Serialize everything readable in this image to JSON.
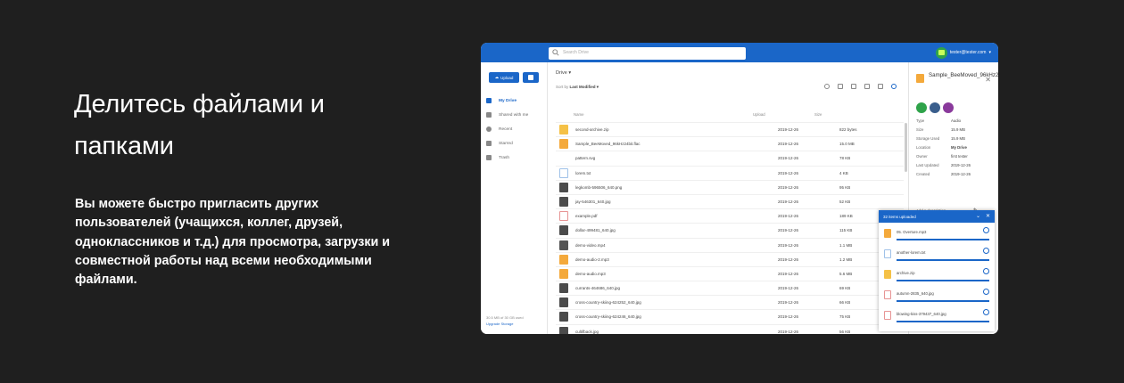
{
  "intro": {
    "headline": "Делитесь файлами и папками",
    "description": "Вы можете быстро пригласить других пользователей (учащихся, коллег, друзей, одноклассников и т.д.) для просмотра, загрузки и совместной работы над всеми необходимыми файлами."
  },
  "app": {
    "search_placeholder": "Search Drive",
    "user_email": "tester@tester.com",
    "upload_label": "Upload",
    "nav": [
      {
        "label": "My Drive",
        "icon": "drive-icon",
        "active": true
      },
      {
        "label": "Shared with me",
        "icon": "people-icon",
        "active": false
      },
      {
        "label": "Recent",
        "icon": "clock-icon",
        "active": false
      },
      {
        "label": "Starred",
        "icon": "star-icon",
        "active": false
      },
      {
        "label": "Trash",
        "icon": "trash-icon",
        "active": false
      }
    ],
    "quota_text": "30.5 MB of 30 GB used",
    "upgrade_label": "Upgrade Storage",
    "breadcrumb": "Drive ▾",
    "sort_prefix": "Sort by",
    "sort_value": "Last Modified ▾",
    "columns": {
      "name": "Name",
      "date": "Upload",
      "size": "Size"
    },
    "files": [
      {
        "name": "second-archive.zip",
        "date": "2019-12-26",
        "size": "822 bytes",
        "type": "zip"
      },
      {
        "name": "Sample_BeeMoved_96kHz24bit.flac",
        "date": "2019-12-26",
        "size": "15.0 MB",
        "type": "aud"
      },
      {
        "name": "pattern.svg",
        "date": "2019-12-26",
        "size": "78 KB",
        "type": "blank"
      },
      {
        "name": "lorem.txt",
        "date": "2019-12-26",
        "size": "4 KB",
        "type": "txt"
      },
      {
        "name": "legkomb-596506_640.png",
        "date": "2019-12-26",
        "size": "95 KB",
        "type": "img"
      },
      {
        "name": "jay-546301_640.jpg",
        "date": "2019-12-26",
        "size": "52 KB",
        "type": "img"
      },
      {
        "name": "example.pdf",
        "date": "2019-12-26",
        "size": "189 KB",
        "type": "pdf"
      },
      {
        "name": "dollar-499481_640.jpg",
        "date": "2019-12-26",
        "size": "115 KB",
        "type": "img"
      },
      {
        "name": "demo-video.mp4",
        "date": "2019-12-26",
        "size": "1.1 MB",
        "type": "vid"
      },
      {
        "name": "demo-audio-2.mp3",
        "date": "2019-12-26",
        "size": "1.2 MB",
        "type": "aud"
      },
      {
        "name": "demo-audio.mp3",
        "date": "2019-12-26",
        "size": "5.6 MB",
        "type": "aud"
      },
      {
        "name": "currants-464686_640.jpg",
        "date": "2019-12-26",
        "size": "69 KB",
        "type": "img"
      },
      {
        "name": "cross-country-skiing-624252_640.jpg",
        "date": "2019-12-26",
        "size": "66 KB",
        "type": "img"
      },
      {
        "name": "cross-country-skiing-624246_640.jpg",
        "date": "2019-12-26",
        "size": "75 KB",
        "type": "img"
      },
      {
        "name": "cultifback.jpg",
        "date": "2019-12-26",
        "size": "56 KB",
        "type": "img"
      }
    ],
    "detail": {
      "title": "Sample_BeeMoved_96kHz24bit.flac",
      "rows": [
        {
          "label": "Type",
          "value": "Audio"
        },
        {
          "label": "Size",
          "value": "15.9 MB"
        },
        {
          "label": "Storage Used",
          "value": "15.9 MB"
        },
        {
          "label": "Location",
          "value": "My Drive"
        },
        {
          "label": "Owner",
          "value": "first tester"
        },
        {
          "label": "Last Updated",
          "value": "2019-12-26"
        },
        {
          "label": "Created",
          "value": "2019-12-26"
        }
      ],
      "add_description": "Add a description"
    },
    "uploads": {
      "title": "32 items uploaded",
      "items": [
        {
          "name": "05. Overture.mp3",
          "type": "aud"
        },
        {
          "name": "another-lorem.txt",
          "type": "txt"
        },
        {
          "name": "archive.zip",
          "type": "zip"
        },
        {
          "name": "autumn-2835_640.jpg",
          "type": "pdf"
        },
        {
          "name": "blowing-kiss-379437_640.jpg",
          "type": "pdf"
        }
      ]
    },
    "colors": {
      "accent": "#1a66c8",
      "background": "#1f1f1f"
    }
  }
}
